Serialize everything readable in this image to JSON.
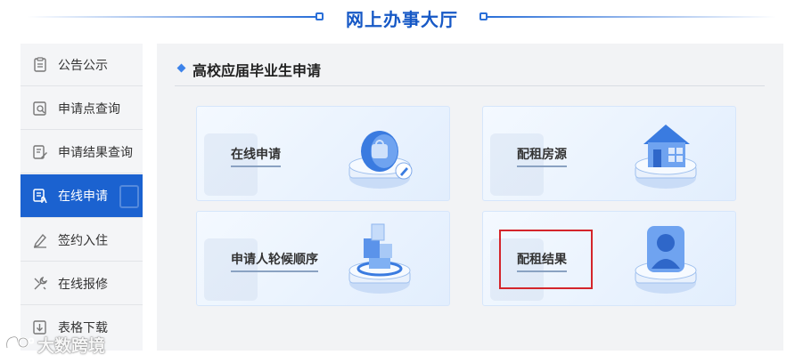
{
  "header": {
    "title": "网上办事大厅"
  },
  "sidebar": {
    "items": [
      {
        "label": "公告公示",
        "icon": "notice-icon",
        "active": false
      },
      {
        "label": "申请点查询",
        "icon": "search-doc-icon",
        "active": false
      },
      {
        "label": "申请结果查询",
        "icon": "edit-doc-icon",
        "active": false
      },
      {
        "label": "在线申请",
        "icon": "online-apply-icon",
        "active": true
      },
      {
        "label": "签约入住",
        "icon": "sign-pen-icon",
        "active": false
      },
      {
        "label": "在线报修",
        "icon": "wrench-icon",
        "active": false
      },
      {
        "label": "表格下载",
        "icon": "download-doc-icon",
        "active": false
      }
    ]
  },
  "main": {
    "section_title": "高校应届毕业生申请",
    "cards": [
      {
        "label": "在线申请",
        "icon": "online-apply-illustration"
      },
      {
        "label": "配租房源",
        "icon": "house-illustration"
      },
      {
        "label": "申请人轮候顺序",
        "icon": "queue-illustration"
      },
      {
        "label": "配租结果",
        "icon": "person-result-illustration"
      }
    ]
  },
  "watermark": {
    "text": "大数跨境"
  },
  "colors": {
    "primary": "#1b62d0",
    "title_blue": "#1759c6",
    "highlight_red": "#d4252b",
    "panel_bg": "#f2f3f5"
  }
}
